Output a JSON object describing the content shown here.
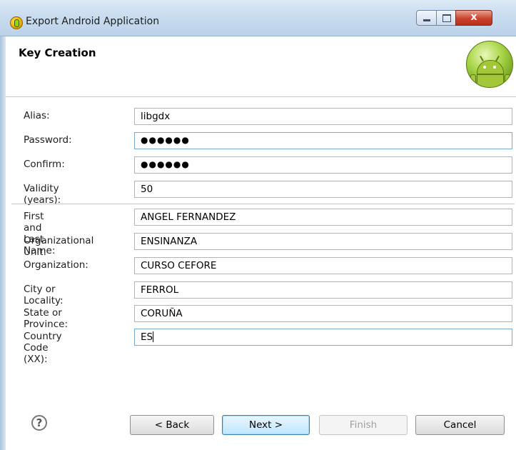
{
  "window": {
    "title": "Export Android Application",
    "close_symbol": "x"
  },
  "header": {
    "title": "Key Creation"
  },
  "form": {
    "alias": {
      "label": "Alias:",
      "value": "libgdx"
    },
    "password": {
      "label": "Password:",
      "value": "●●●●●●"
    },
    "confirm": {
      "label": "Confirm:",
      "value": "●●●●●●"
    },
    "validity": {
      "label": "Validity (years):",
      "value": "50"
    },
    "name": {
      "label": "First and Last Name:",
      "value": "ANGEL FERNANDEZ"
    },
    "org_unit": {
      "label": "Organizational Unit:",
      "value": "ENSINANZA"
    },
    "organization": {
      "label": "Organization:",
      "value": "CURSO CEFORE"
    },
    "city": {
      "label": "City or Locality:",
      "value": "FERROL"
    },
    "state": {
      "label": "State or Province:",
      "value": "CORUÑA"
    },
    "country": {
      "label": "Country Code (XX):",
      "value": "ES"
    }
  },
  "footer": {
    "help_symbol": "?",
    "back_label": "< Back",
    "next_label": "Next >",
    "finish_label": "Finish",
    "cancel_label": "Cancel"
  }
}
